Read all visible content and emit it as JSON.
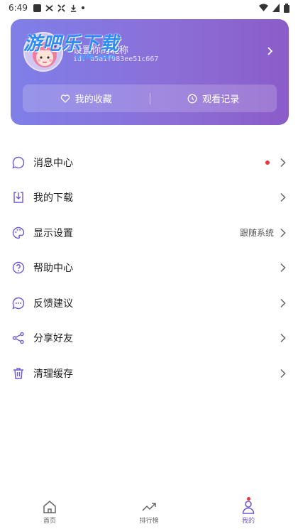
{
  "status_bar": {
    "time": "6:49"
  },
  "watermark": {
    "text": "游吧乐下载",
    "sub": "yyle.com"
  },
  "profile": {
    "nickname_placeholder": "设置你的昵称",
    "id_text": "id: d5a1f983ee51c667",
    "favorites_label": "我的收藏",
    "history_label": "观看记录"
  },
  "menu": {
    "items": [
      {
        "label": "消息中心",
        "icon": "message-icon"
      },
      {
        "label": "我的下载",
        "icon": "download-icon"
      },
      {
        "label": "显示设置",
        "icon": "palette-icon",
        "value": "跟随系统"
      },
      {
        "label": "帮助中心",
        "icon": "help-icon"
      },
      {
        "label": "反馈建议",
        "icon": "feedback-icon"
      },
      {
        "label": "分享好友",
        "icon": "share-icon"
      },
      {
        "label": "清理缓存",
        "icon": "trash-icon"
      }
    ]
  },
  "tabbar": {
    "tabs": [
      {
        "label": "首页",
        "icon": "home-icon"
      },
      {
        "label": "排行榜",
        "icon": "trending-icon"
      },
      {
        "label": "我的",
        "icon": "user-icon"
      }
    ]
  },
  "colors": {
    "accent": "#6c5bd4",
    "card_start": "#7f7fe8",
    "card_end": "#8b5cc9",
    "badge": "#e8383d"
  }
}
